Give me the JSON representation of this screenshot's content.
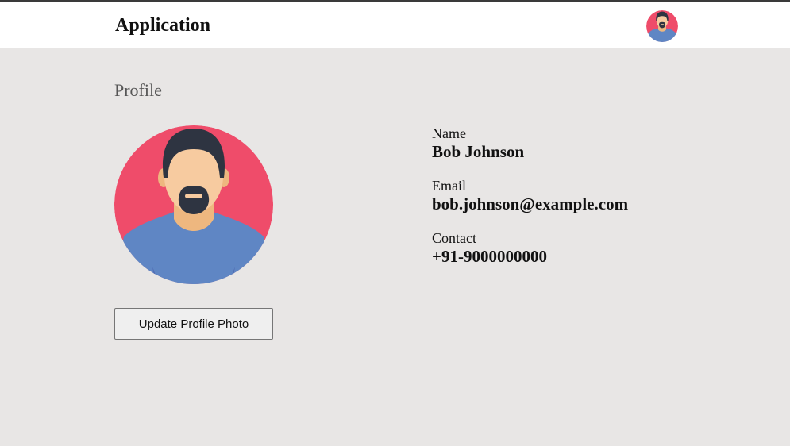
{
  "header": {
    "app_title": "Application",
    "avatar_icon": "user-avatar-icon"
  },
  "page": {
    "title": "Profile"
  },
  "profile": {
    "avatar_icon": "user-avatar-icon",
    "update_photo_label": "Update Profile Photo",
    "fields": [
      {
        "label": "Name",
        "value": "Bob Johnson"
      },
      {
        "label": "Email",
        "value": "bob.johnson@example.com"
      },
      {
        "label": "Contact",
        "value": "+91-9000000000"
      }
    ]
  },
  "colors": {
    "avatar_background": "#ef4c6a",
    "shirt": "#5f86c4",
    "skin": "#f7cba0",
    "hair": "#2e3441",
    "page_background": "#e8e6e5",
    "header_background": "#ffffff"
  }
}
